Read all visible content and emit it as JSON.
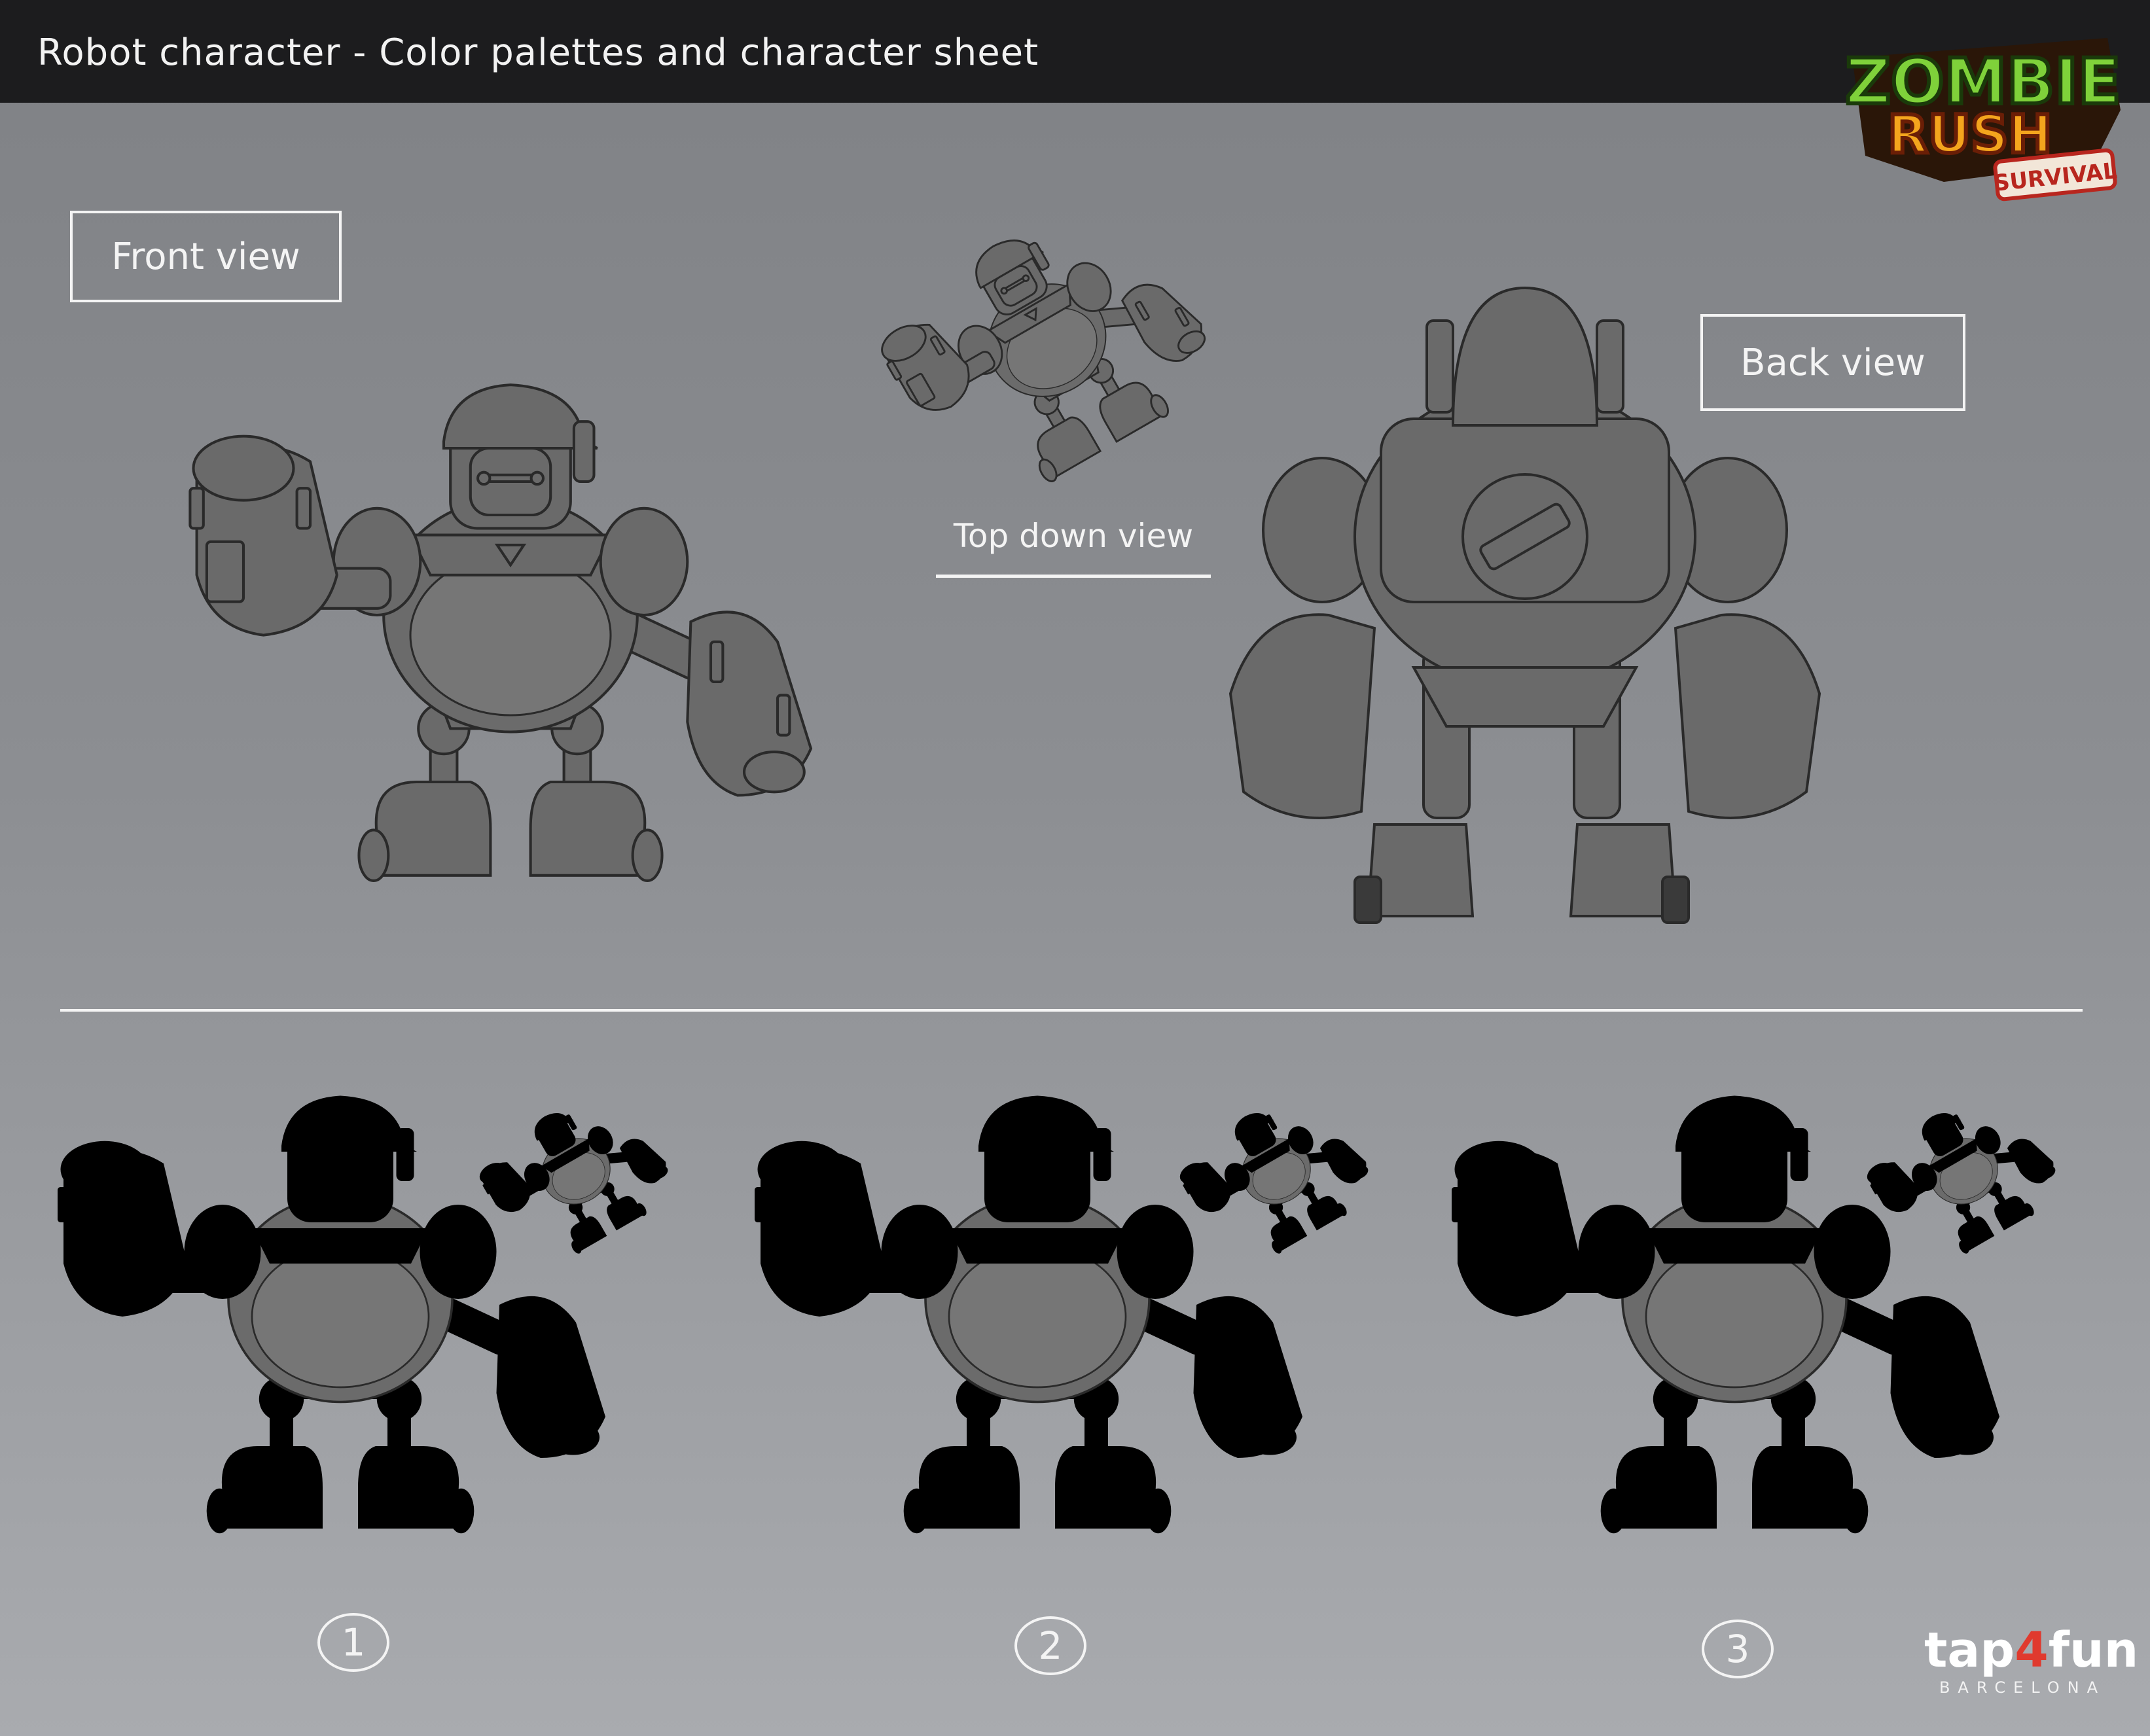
{
  "header": {
    "title": "Robot character - Color palettes and character sheet"
  },
  "logo": {
    "line1": "ZOMBIE",
    "line2": "RUSH",
    "line3": "SURVIVAL"
  },
  "labels": {
    "front": "Front view",
    "top": "Top down view",
    "back": "Back view"
  },
  "palettes": [
    {
      "number": "1",
      "body": "#1f7f86",
      "accent": "#d62c43",
      "hat": "#d42b3d",
      "limbs": "#28b3b0",
      "joint": "#6fcac7"
    },
    {
      "number": "2",
      "body": "#6b4532",
      "accent": "#f7a01f",
      "hat": "#6a2a32",
      "limbs": "#f39a1d",
      "joint": "#c74a9e"
    },
    {
      "number": "3",
      "body": "#d6c7a6",
      "accent": "#4e6a45",
      "hat": "#f0a02a",
      "limbs": "#4e6a45",
      "joint": "#9aa592"
    }
  ],
  "brand": {
    "main_a": "tap",
    "main_b": "4",
    "main_c": "fun",
    "sub": "BARCELONA"
  }
}
